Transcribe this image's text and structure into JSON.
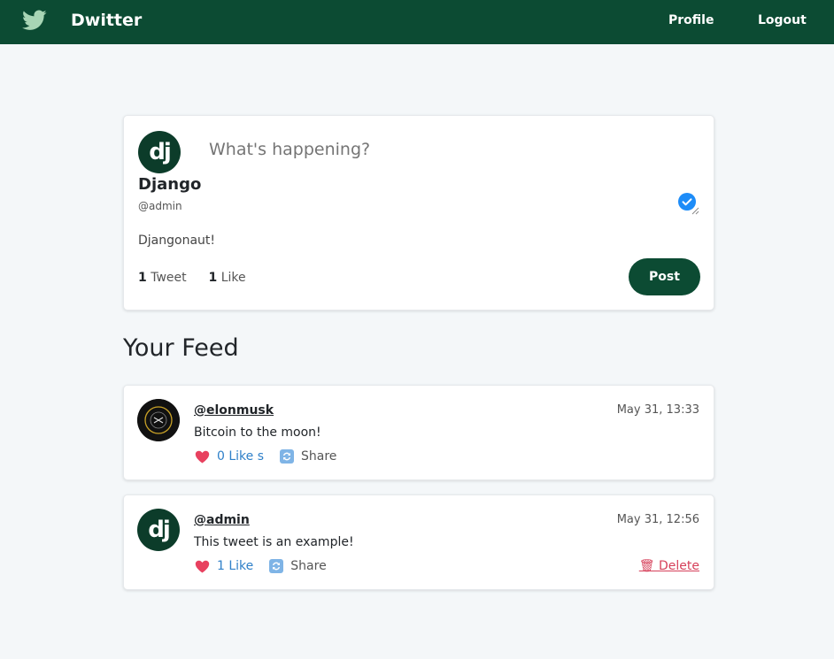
{
  "nav": {
    "brand": "Dwitter",
    "profile_label": "Profile",
    "logout_label": "Logout"
  },
  "profile": {
    "avatar_text": "dj",
    "prompt_placeholder": "What's happening?",
    "name": "Django",
    "handle": "@admin",
    "bio": "Djangonaut!",
    "tweet_count": "1",
    "tweet_label": "Tweet",
    "like_count": "1",
    "like_label": "Like",
    "post_label": "Post"
  },
  "feed": {
    "title": "Your Feed",
    "tweets": [
      {
        "handle": "@elonmusk",
        "time": "May 31, 13:33",
        "text": "Bitcoin to the moon!",
        "likes": "0 Like s",
        "share": "Share"
      },
      {
        "avatar_text": "dj",
        "handle": "@admin",
        "time": "May 31, 12:56",
        "text": "This tweet is an example!",
        "likes": "1 Like",
        "share": "Share",
        "delete": "🗑 Delete"
      }
    ]
  },
  "colors": {
    "nav_bg": "#0c4b33",
    "page_bg": "#f4f7f9",
    "like_blue": "#2f80c9",
    "delete_red": "#d6405a",
    "heart": "#e8415f"
  }
}
